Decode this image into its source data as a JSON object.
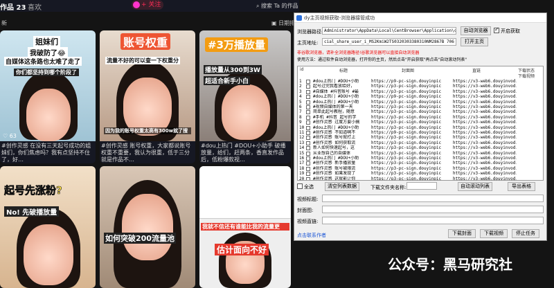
{
  "douyin": {
    "works_tab": "作品 23",
    "likes_tab": "喜欢",
    "follow_label": "+ 关注",
    "search_placeholder": "搜索 Ta 的作品",
    "latest_label": "新",
    "top_right_label": "日期排",
    "cards": [
      {
        "caption1": "姐妹们",
        "caption2": "我破防了😂",
        "caption3": "自媒体这条路也太难了走了",
        "caption4": "你们都坚持到哪个阶段了",
        "likes": "♡ 63",
        "desc": "#创作灵感 在没有三天起号成功的姐妹们，你们焦虑吗？我有点坚持不住了，好…"
      },
      {
        "caption1": "账号权重",
        "caption2": "流量不好的可以查一下权重分",
        "caption3": "因为我的账号权重太高有300w就了搜",
        "likes": "",
        "desc": "#创作灵感 账号权重，大家都说账号权重不重要，我认为很重，低于三分就是作品不…"
      },
      {
        "caption1": "#3万播放量",
        "caption2": "播放量从300到3W",
        "caption3": "超适合新手小白",
        "likes": "",
        "desc": "#dou上热门 #DOU+小助手 破播放量，给们，赶两条，香直发作品后，低粉爆款视…"
      },
      {
        "caption1": "起号先涨粉?",
        "caption2": "No! 先破播放量",
        "likes": "",
        "desc": ""
      },
      {
        "caption1": "如何突破200流量池",
        "likes": "",
        "desc": ""
      },
      {
        "caption1": "我就不信还有谁能比我的流量更",
        "caption2": "估计面向不好",
        "likes": "",
        "desc": ""
      }
    ]
  },
  "tool": {
    "title": "dy主页视频获取-浏览器接管成功",
    "browser_path_label": "浏览器路径:",
    "browser_path_value": "Administrator\\AppData\\Local\\CentBrowser\\Application\\chrome.exe",
    "auto_browser_btn": "自动浏览器",
    "start_get_label": "开启获取",
    "homepage_label": "主页地址:",
    "homepage_value": "cial_share_user_i_MS2KmiW2TS0320303380310NM2867B 706 con 2pm",
    "open_homepage_btn": "打开主页",
    "warning_line1": "非谷歌浏览器，请补全浏览器路径!谷歌浏览器可以直接自动浏览器",
    "warning_line2": "使用方法：通过软件自动浏览器，打开你的主页，然后点击\"开启获取\"再点击\"自动滚动列表\"",
    "columns": [
      "id",
      "标题",
      "封面图",
      "直链",
      "下载状态"
    ],
    "col_extra": "下载视频",
    "rows": [
      {
        "id": "1",
        "title": "#dou上热门 #DOU+小助",
        "cover": "https://p9-pc-sign.douyinpic",
        "link": "https://v3-web6.douyinvod.com"
      },
      {
        "id": "2",
        "title": "起号过完我看放给好，",
        "cover": "https://p3-pc-sign.douyinpic",
        "link": "https://v3-web6.douyinvod.com"
      },
      {
        "id": "3",
        "title": "#自媒体 #抖音账号 #最",
        "cover": "https://p3-pc-sign.douyinpic",
        "link": "https://v3-web6.douyinvod.com"
      },
      {
        "id": "4",
        "title": "#dou上热门 #DOU+小助",
        "cover": "https://p9-pc-sign.douyinpic",
        "link": "https://v3-web6.douyinvod.com"
      },
      {
        "id": "5",
        "title": "#dou上热门 #DOU+小助",
        "cover": "https://p3-pc-sign.douyinpic",
        "link": "https://v3-web6.douyinvod.com"
      },
      {
        "id": "6",
        "title": "#视频自媒体的第一天",
        "cover": "https://p3-pc-sign.douyinpic",
        "link": "https://v3-web6.douyinvod.com"
      },
      {
        "id": "7",
        "title": "简单此起号教程，随意",
        "cover": "https://p3-pc-sign.douyinpic",
        "link": "https://v3-web6.douyinvod.com"
      },
      {
        "id": "8",
        "title": "#手机 #抖音 起号的学",
        "cover": "https://p3-pc-sign.douyinpic",
        "link": "https://v3-web6.douyinvod.com"
      },
      {
        "id": "9",
        "title": "#创作灵感 过度方要小搞",
        "cover": "https://p3-pc-sign.douyinpic",
        "link": "https://v3-web6.douyinvod.com"
      },
      {
        "id": "10",
        "title": "#dou上热门 #DOU+小助",
        "cover": "https://p3-pc-sign.douyinpic",
        "link": "https://v3-web6.douyinvod.com"
      },
      {
        "id": "11",
        "title": "#创作灵感 不知道啊不",
        "cover": "https://p9-pc-sign.douyinpic",
        "link": "https://v3-web6.douyinvod.com"
      },
      {
        "id": "12",
        "title": "#创作灵感 账号就打上",
        "cover": "https://p3-pc-sign.douyinpic",
        "link": "https://v3-web6.douyinvod.com"
      },
      {
        "id": "13",
        "title": "#创作灵感 如何获取流",
        "cover": "https://p3-pc-sign.douyinpic",
        "link": "https://v3-web6.douyinvod.com"
      },
      {
        "id": "14",
        "title": "新人如何快速起号，这",
        "cover": "https://p3-pc-sign.douyinpic",
        "link": "https://v3-web6.douyinvod.com"
      },
      {
        "id": "15",
        "title": "从业想自己的自媒体",
        "cover": "https://p3-pc-sign.douyinpic",
        "link": "https://v3-web6.douyinvod.com"
      },
      {
        "id": "16",
        "title": "#dou上热门 #DOU+小助",
        "cover": "https://p3-pc-sign.douyinpic",
        "link": "https://v3-web6.douyinvod.com"
      },
      {
        "id": "17",
        "title": "#创作灵感 新手播放量",
        "cover": "https://p3-pc-sign.douyinpic",
        "link": "https://v3-web6.douyinvod.com"
      },
      {
        "id": "18",
        "title": "#创作灵感 账号被限流",
        "cover": "https://p3-pc-sign.douyinpic",
        "link": "https://v3-web6.douyinvod.com"
      },
      {
        "id": "19",
        "title": "#创作灵感 如果发现了",
        "cover": "https://p3-pc-sign.douyinpic",
        "link": "https://v3-web6.douyinvod.com"
      },
      {
        "id": "20",
        "title": "#创作灵感 这就能让你",
        "cover": "https://p3-pc-sign.douyinpic",
        "link": "https://v3-web6.douyinvod.com"
      }
    ],
    "select_all": "全选",
    "clear_list_btn": "清空列表数据",
    "download_folder_label": "下载文件夹名称:",
    "auto_scroll_btn": "自动滚动列表",
    "export_btn": "导出表格",
    "video_title_label": "视频标题:",
    "cover_label": "封面图:",
    "video_link_label": "视频直链:",
    "download_cover_btn": "下载封面",
    "download_video_btn": "下载视频",
    "stop_btn": "停止任务",
    "footer_link": "点击联系作者"
  },
  "watermark": "公众号：黑马研究社"
}
